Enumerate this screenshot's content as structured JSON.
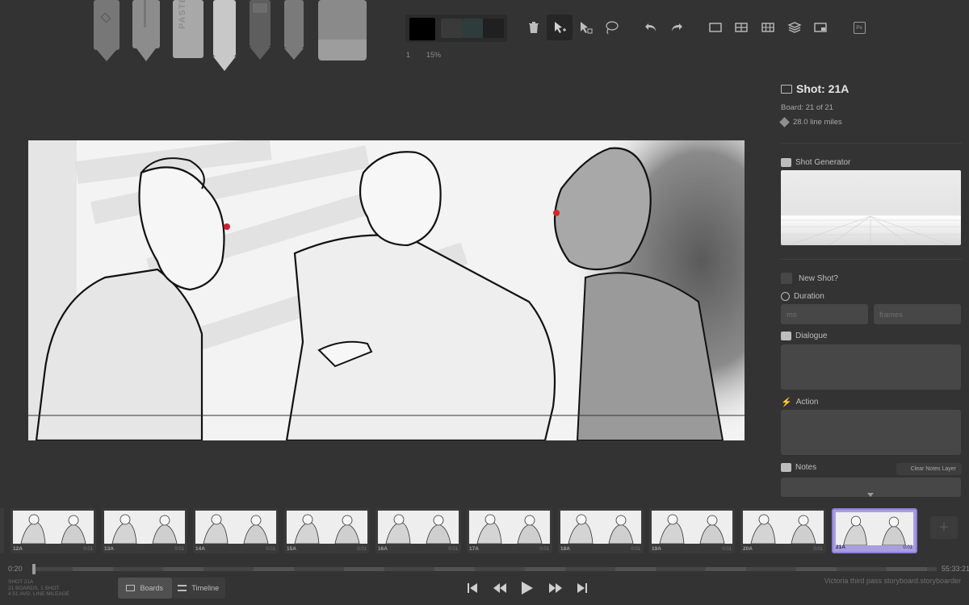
{
  "toolbar": {
    "tools": [
      {
        "name": "marker"
      },
      {
        "name": "pencil"
      },
      {
        "name": "pastel"
      },
      {
        "name": "light-pencil"
      },
      {
        "name": "pen"
      },
      {
        "name": "brush"
      },
      {
        "name": "eraser"
      }
    ],
    "pastel_text": "PASTEL",
    "swatches": [
      "#000000",
      "#3a3a3a",
      "#2e3d3b",
      "#202020"
    ],
    "brush_size": "1",
    "opacity": "15%",
    "actions": [
      "trash-icon",
      "move-icon",
      "scale-icon",
      "lasso-icon",
      "undo-icon",
      "redo-icon",
      "layout-single-icon",
      "layout-grid-icon",
      "layout-table-icon",
      "layers-icon",
      "onion-skin-icon",
      "photoshop-icon"
    ],
    "photoshop_label": "Ps"
  },
  "panel": {
    "shot_title": "Shot: 21A",
    "board_info": "Board: 21 of 21",
    "line_miles": "28.0 line miles",
    "shot_generator_label": "Shot Generator",
    "new_shot_label": "New Shot?",
    "duration_label": "Duration",
    "ms_placeholder": "ms",
    "frames_placeholder": "frames",
    "dialogue_label": "Dialogue",
    "action_label": "Action",
    "notes_label": "Notes",
    "clear_notes_label": "Clear Notes Layer"
  },
  "timeline": {
    "thumbs": [
      {
        "label": "12A",
        "duration": "0:01"
      },
      {
        "label": "13A",
        "duration": "0:01"
      },
      {
        "label": "14A",
        "duration": "0:01"
      },
      {
        "label": "15A",
        "duration": "0:01"
      },
      {
        "label": "16A",
        "duration": "0:01"
      },
      {
        "label": "17A",
        "duration": "0:01"
      },
      {
        "label": "18A",
        "duration": "0:01"
      },
      {
        "label": "19A",
        "duration": "0:01"
      },
      {
        "label": "20A",
        "duration": "0:01"
      },
      {
        "label": "21A",
        "duration": "0:01",
        "active": true
      }
    ],
    "time_start": "0:20",
    "time_end": "55:33:21"
  },
  "bottom": {
    "stats": [
      "SHOT 21A",
      "21 BOARDS, 1 SHOT",
      "4.51 AVG. LINE MILEAGE"
    ],
    "boards_label": "Boards",
    "timeline_label": "Timeline",
    "filename": "Victoria third pass storyboard.storyboarder"
  },
  "colors": {
    "accent": "#a99ee0",
    "background": "#333333"
  }
}
